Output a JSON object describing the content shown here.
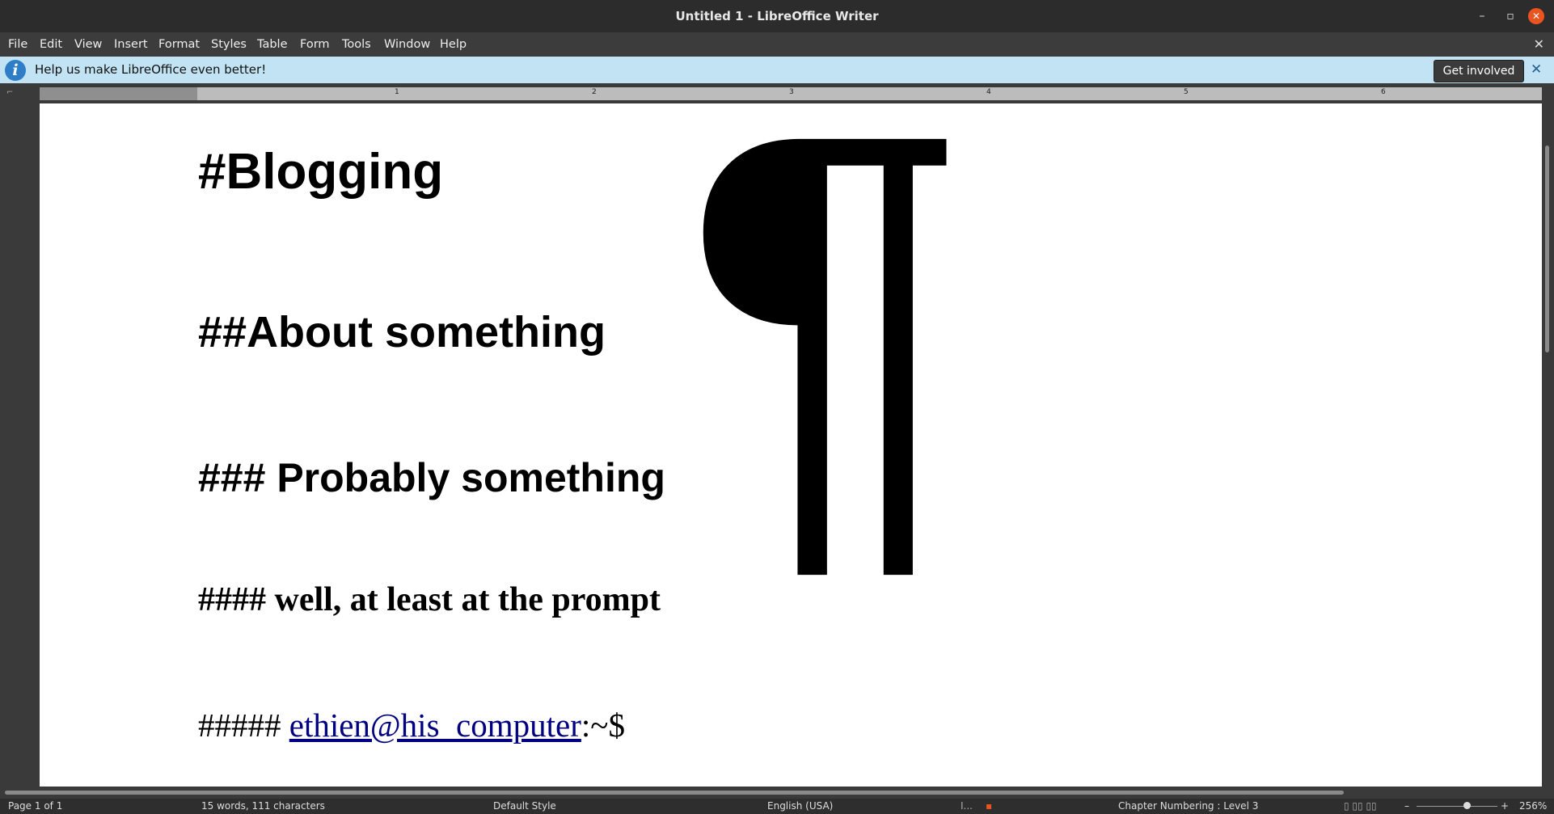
{
  "window": {
    "title": "Untitled 1 - LibreOffice Writer",
    "minimize_glyph": "–",
    "maximize_glyph": "▫",
    "close_glyph": "✕"
  },
  "menu": {
    "items": [
      "File",
      "Edit",
      "View",
      "Insert",
      "Format",
      "Styles",
      "Table",
      "Form",
      "Tools",
      "Window",
      "Help"
    ],
    "close_glyph": "✕"
  },
  "infobar": {
    "icon": "info-icon",
    "icon_glyph": "i",
    "message": "Help us make LibreOffice even better!",
    "button_label": "Get involved",
    "close_glyph": "✕",
    "background_color": "#c2e3f3"
  },
  "ruler": {
    "corner_glyph": "⌐",
    "numbers": [
      "1",
      "2",
      "3",
      "4",
      "5",
      "6"
    ]
  },
  "document": {
    "heading1": "#Blogging",
    "heading2": "##About something",
    "heading3": "### Probably something",
    "heading4": "#### well, at least at the prompt",
    "heading5_prefix": "##### ",
    "heading5_link": "ethien@his_computer",
    "heading5_suffix": ":~$",
    "pilcrow": "¶",
    "link_color": "#000080"
  },
  "status": {
    "page": "Page 1 of 1",
    "word_count": "15 words, 111 characters",
    "page_style": "Default Style",
    "language": "English (USA)",
    "selection_mode_glyph": "I...",
    "modified_icon_glyph": "▪",
    "outline": "Chapter Numbering : Level 3",
    "view_layout_glyphs": "▯ ▯▯ ▯▯",
    "zoom_minus": "–",
    "zoom_plus": "+",
    "zoom": "256%"
  }
}
